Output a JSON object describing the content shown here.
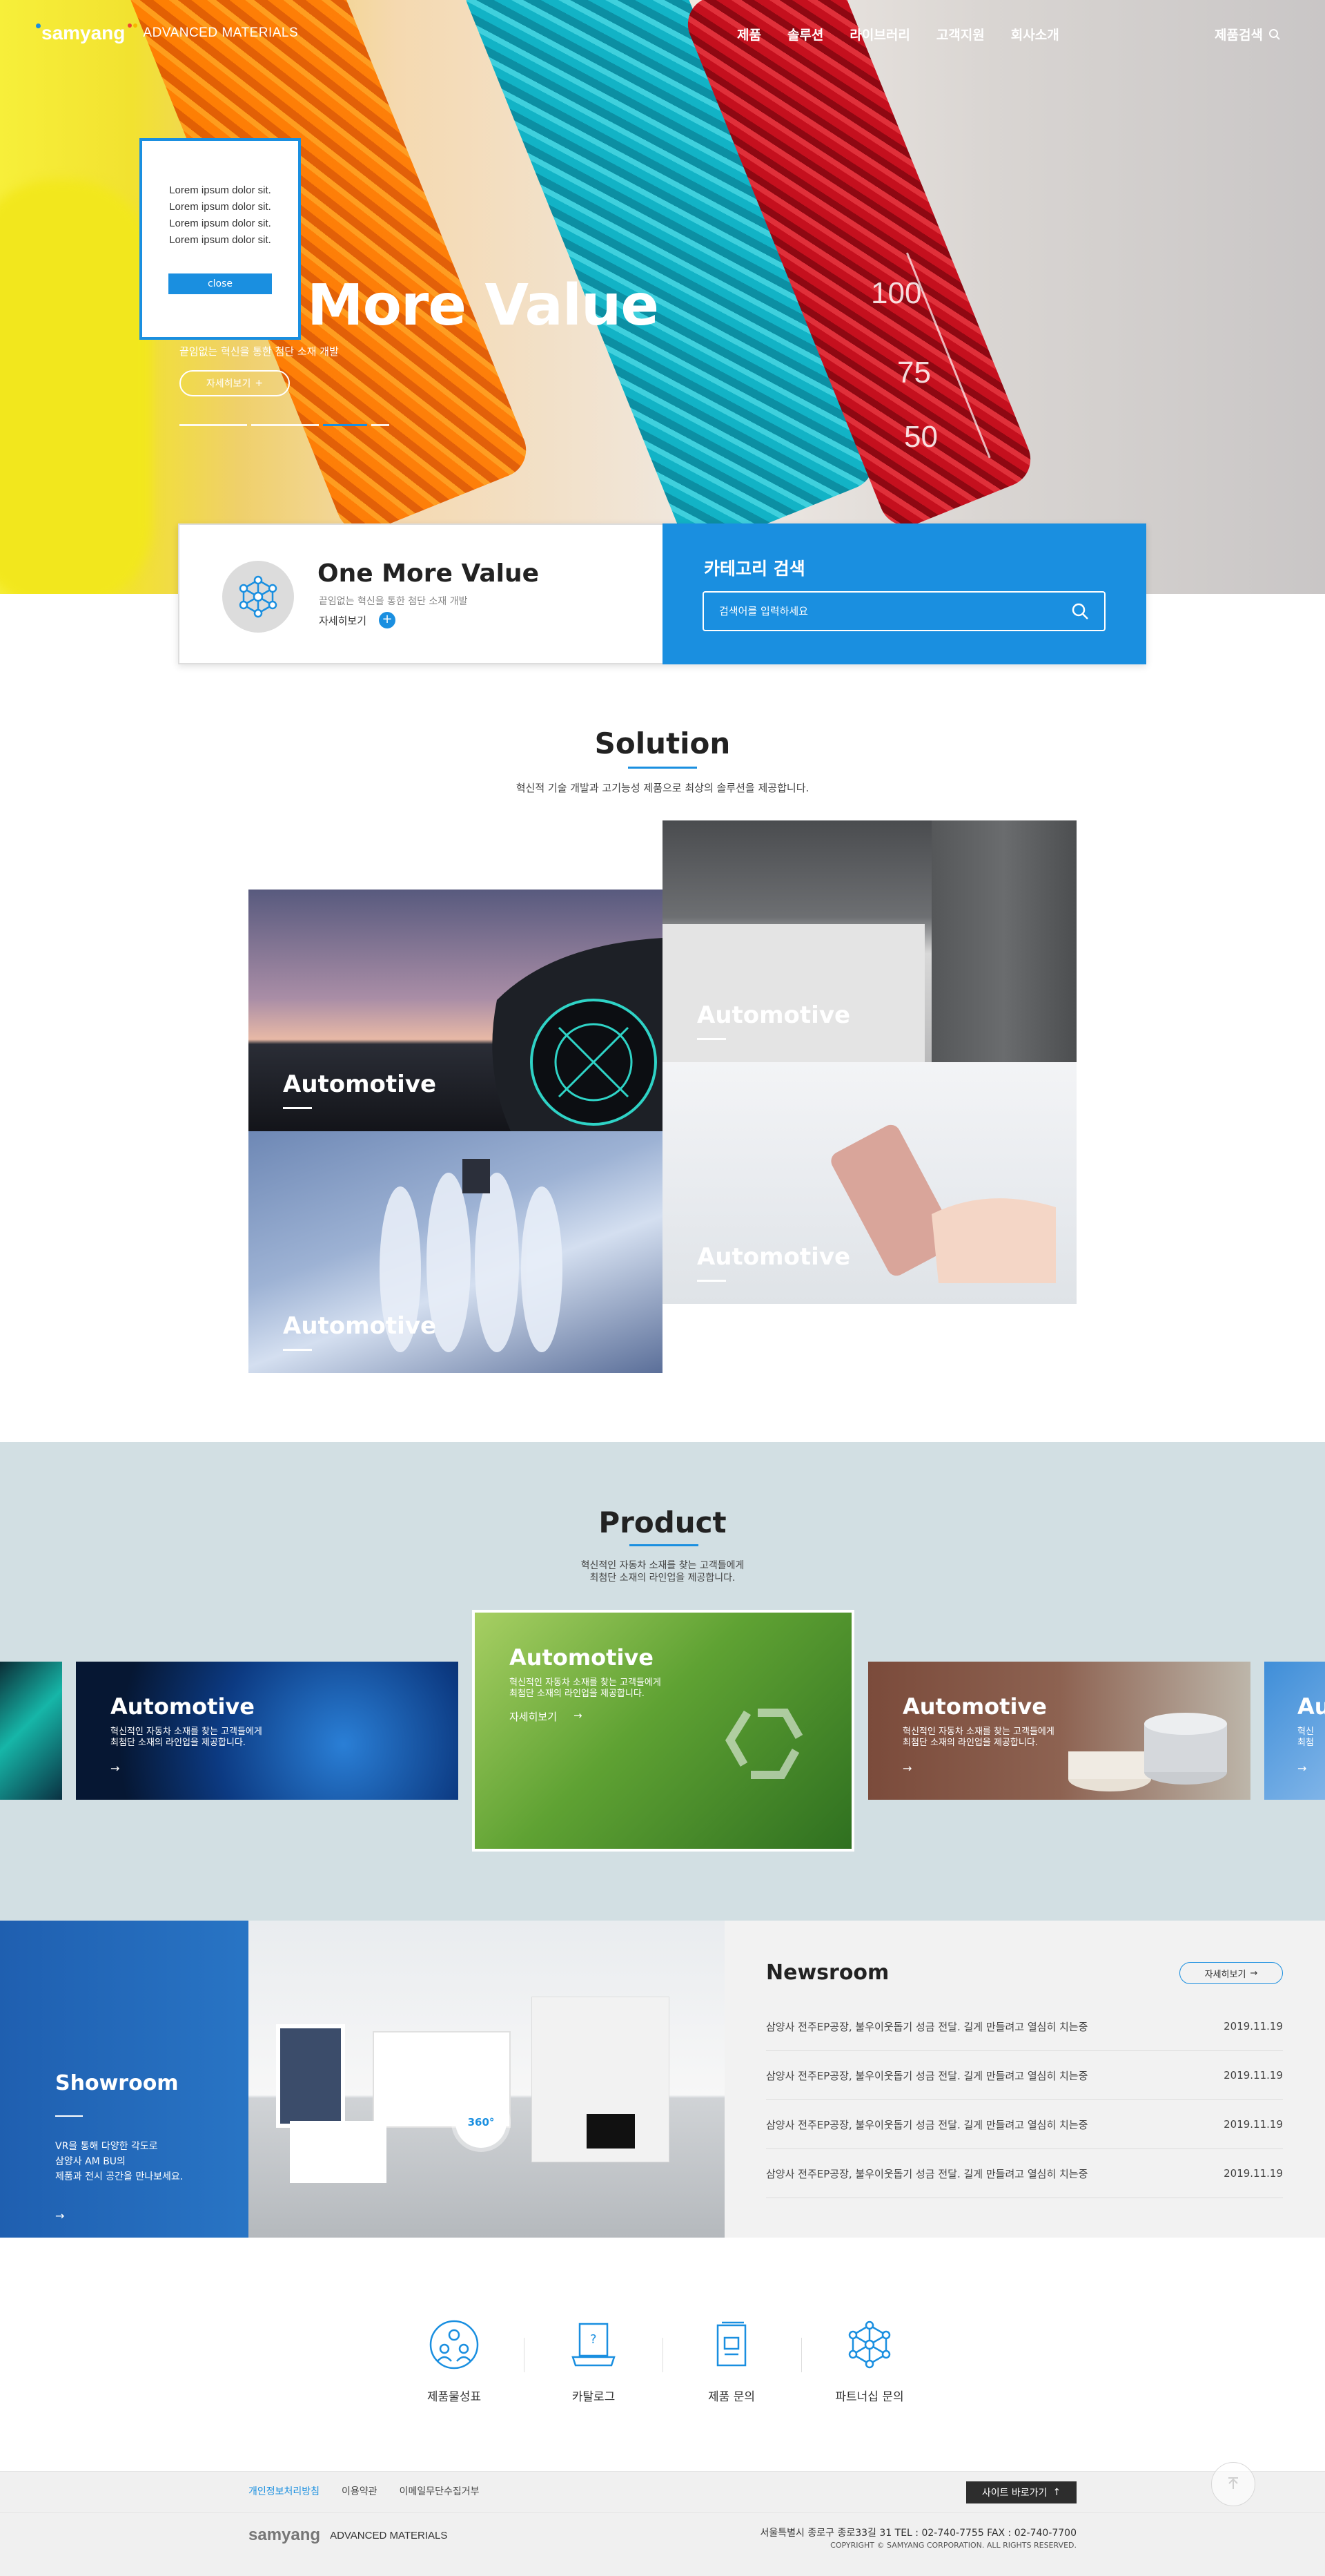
{
  "header": {
    "logo": "samyang",
    "logo_sub": "ADVANCED MATERIALS",
    "nav": [
      "제품",
      "솔루션",
      "라이브러리",
      "고객지원",
      "회사소개"
    ],
    "product_search": "제품검색"
  },
  "popup": {
    "lines": [
      "Lorem ipsum dolor sit.",
      "Lorem ipsum dolor sit.",
      "Lorem ipsum dolor sit.",
      "Lorem ipsum dolor sit."
    ],
    "close": "close"
  },
  "hero": {
    "title": "More Value",
    "subtitle": "끝임없는 혁신을 통한 첨단 소재 개발",
    "more": "자세히보기"
  },
  "infocard": {
    "title": "One More Value",
    "subtitle": "끝임없는 혁신을 통한 첨단 소재 개발",
    "more": "자세히보기",
    "category_title": "카테고리 검색",
    "search_placeholder": "검색어를 입력하세요"
  },
  "solution": {
    "title": "Solution",
    "desc": "혁신적 기술 개발과 고기능성 제품으로 최상의 솔루션을 제공합니다.",
    "tiles": [
      "Automotive",
      "Automotive",
      "Automotive",
      "Automotive"
    ]
  },
  "product": {
    "title": "Product",
    "desc_1": "혁신적인 자동차 소재를 찾는 고객들에게",
    "desc_2": "최첨단 소재의 라인업을 제공합니다.",
    "cards": [
      {
        "title": "Automotive",
        "desc_1": "혁신적인 자동차 소재를 찾는 고객들에게",
        "desc_2": "최첨단 소재의 라인업을 제공합니다.",
        "more": ""
      },
      {
        "title": "Automotive",
        "desc_1": "혁신적인 자동차 소재를 찾는 고객들에게",
        "desc_2": "최첨단 소재의 라인업을 제공합니다.",
        "more": "자세히보기"
      },
      {
        "title": "Automotive",
        "desc_1": "혁신적인 자동차 소재를 찾는 고객들에게",
        "desc_2": "최첨단 소재의 라인업을 제공합니다.",
        "more": ""
      },
      {
        "title": "Au",
        "desc_1": "혁신",
        "desc_2": "최첨",
        "more": ""
      }
    ]
  },
  "showroom": {
    "title": "Showroom",
    "desc_1": "VR을 통해 다양한 각도로",
    "desc_2": "삼양사 AM BU의",
    "desc_3": "제품과 전시 공간을 만나보세요.",
    "badge": "360°"
  },
  "news": {
    "title": "Newsroom",
    "more": "자세히보기",
    "items": [
      {
        "text": "삼양사 전주EP공장, 불우이웃돕기 성금 전달. 길게 만들려고 열심히 치는중",
        "date": "2019.11.19"
      },
      {
        "text": "삼양사 전주EP공장, 불우이웃돕기 성금 전달. 길게 만들려고 열심히 치는중",
        "date": "2019.11.19"
      },
      {
        "text": "삼양사 전주EP공장, 불우이웃돕기 성금 전달. 길게 만들려고 열심히 치는중",
        "date": "2019.11.19"
      },
      {
        "text": "삼양사 전주EP공장, 불우이웃돕기 성금 전달. 길게 만들려고 열심히 치는중",
        "date": "2019.11.19"
      }
    ]
  },
  "quicklinks": [
    "제품물성표",
    "카탈로그",
    "제품 문의",
    "파트너십 문의"
  ],
  "footer": {
    "links": [
      "개인정보처리방침",
      "이용약관",
      "이메일무단수집거부"
    ],
    "site_button": "사이트 바로가기",
    "logo": "samyang",
    "logo_sub": "ADVANCED MATERIALS",
    "address": "서울특별시 종로구 종로33길 31 TEL : 02-740-7755 FAX : 02-740-7700",
    "copyright": "COPYRIGHT © SAMYANG CORPORATION. ALL RIGHTS RESERVED."
  },
  "colors": {
    "accent": "#1a8fe0",
    "product_bg": "#d2dfe3",
    "news_bg": "#f2f2f2",
    "footer_bg": "#f0f0f0"
  }
}
